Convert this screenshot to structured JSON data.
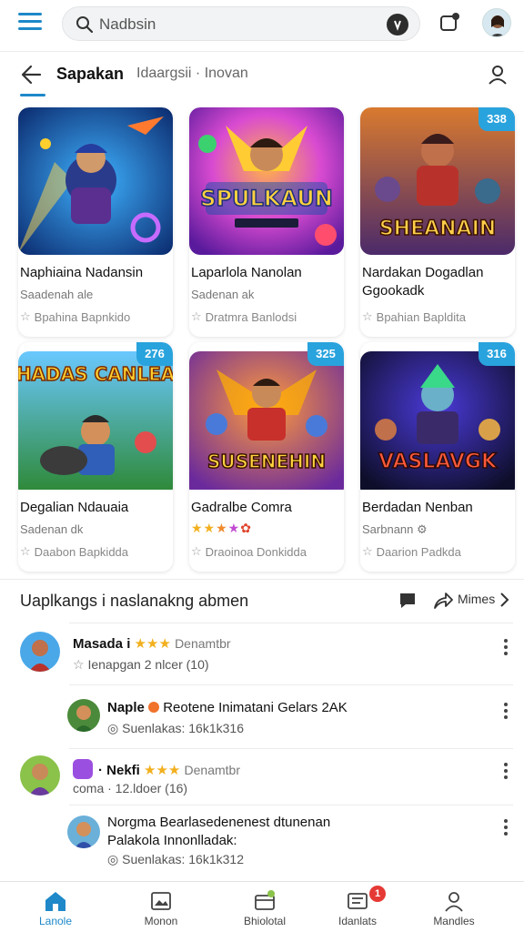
{
  "search": {
    "placeholder": "Nadbsin",
    "value": "Nadbsin"
  },
  "subnav": {
    "title": "Sapakan",
    "breadcrumb": "Idaargsii · Inovan"
  },
  "cards": [
    {
      "title": "Naphiaina Nadansin",
      "sub": "Saadenah ale",
      "meta": "Bpahina Bapnkido",
      "badge": "",
      "art_text": ""
    },
    {
      "title": "Laparlola Nanolan",
      "sub": "Sadenan ak",
      "meta": "Dratmra Banlodsi",
      "badge": "",
      "art_text": "SPULKAUN"
    },
    {
      "title": "Nardakan Dogadlan Ggookadk",
      "sub": "",
      "meta": "Bpahian Bapldita",
      "badge": "338",
      "art_text": "SHEANAIN"
    },
    {
      "title": "Degalian Ndauaia",
      "sub": "Sadenan dk",
      "meta": "Daabon Bapkidda",
      "badge": "276",
      "art_text": "SHADAS CANLEAS"
    },
    {
      "title": "Gadralbe Comra",
      "sub": "",
      "meta": "Draoinoa Donkidda",
      "badge": "325",
      "art_text": "SUSENEHIN"
    },
    {
      "title": "Berdadan Nenban",
      "sub": "Sarbnann",
      "meta": "Daarion Padkda",
      "badge": "316",
      "art_text": "VASLAVGK"
    }
  ],
  "section": {
    "title": "Uaplkangs i naslanakng abmen",
    "more": "Mimes"
  },
  "comments": [
    {
      "name": "Masada i",
      "tail": "Denamtbr",
      "line": "Ienapgan 2 nlcer (10)"
    },
    {
      "name": "Naple",
      "tail": "Reotene Inimatani Gelars 2AK",
      "line": "Suenlakas: 16k1k316"
    },
    {
      "name": "· Nekfi",
      "tail": "Denamtbr",
      "line": "coma  · 12.ldoer (16)"
    },
    {
      "text1": "Norgma Bearlasedenenest dtunenan",
      "text2": "Palakola Innonlladak:",
      "line": "Suenlakas: 16k1k312"
    }
  ],
  "bottom_nav": [
    {
      "label": "Lanole",
      "active": true
    },
    {
      "label": "Monon",
      "active": false
    },
    {
      "label": "Bhiolotal",
      "active": false
    },
    {
      "label": "Idanlats",
      "active": false,
      "badge": "1"
    },
    {
      "label": "Mandles",
      "active": false
    }
  ],
  "colors": {
    "accent": "#1e88c9",
    "badge": "#29a3dd",
    "notification": "#e53935",
    "star": "#f2b01e"
  }
}
